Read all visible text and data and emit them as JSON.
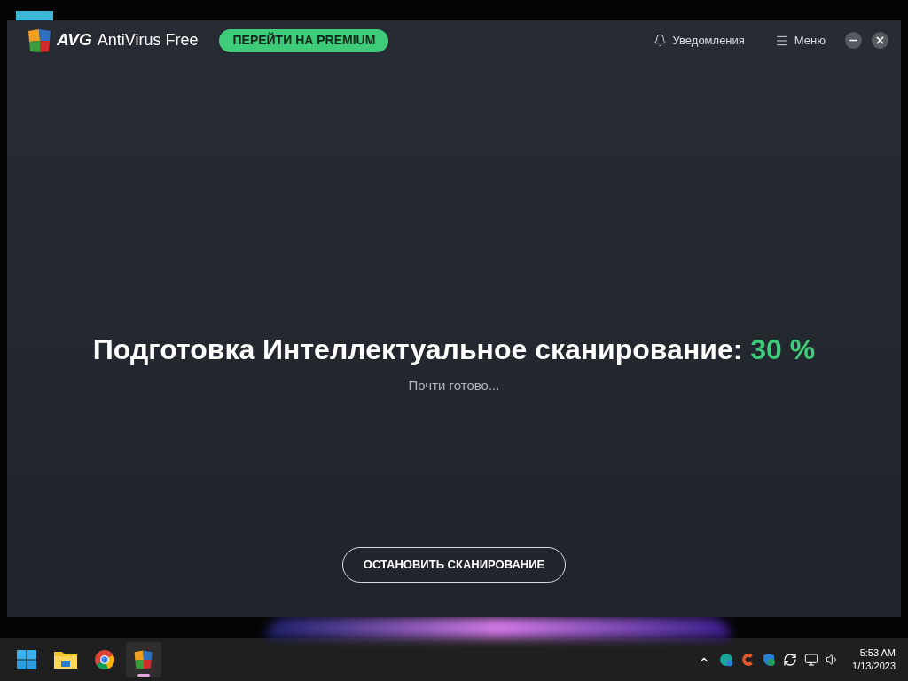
{
  "window": {
    "brand": "AVG",
    "product": "AntiVirus Free",
    "premium_button": "ПЕРЕЙТИ НА PREMIUM",
    "notifications": "Уведомления",
    "menu": "Меню"
  },
  "scan": {
    "title": "Подготовка Интеллектуальное сканирование:",
    "percent": "30 %",
    "status": "Почти готово...",
    "stop_button": "ОСТАНОВИТЬ СКАНИРОВАНИЕ"
  },
  "taskbar": {
    "apps": [
      {
        "kind": "start",
        "selected": false
      },
      {
        "kind": "explorer",
        "selected": false
      },
      {
        "kind": "chrome",
        "selected": false
      },
      {
        "kind": "avg",
        "selected": true
      }
    ],
    "time": "5:53 AM",
    "date": "1/13/2023"
  }
}
